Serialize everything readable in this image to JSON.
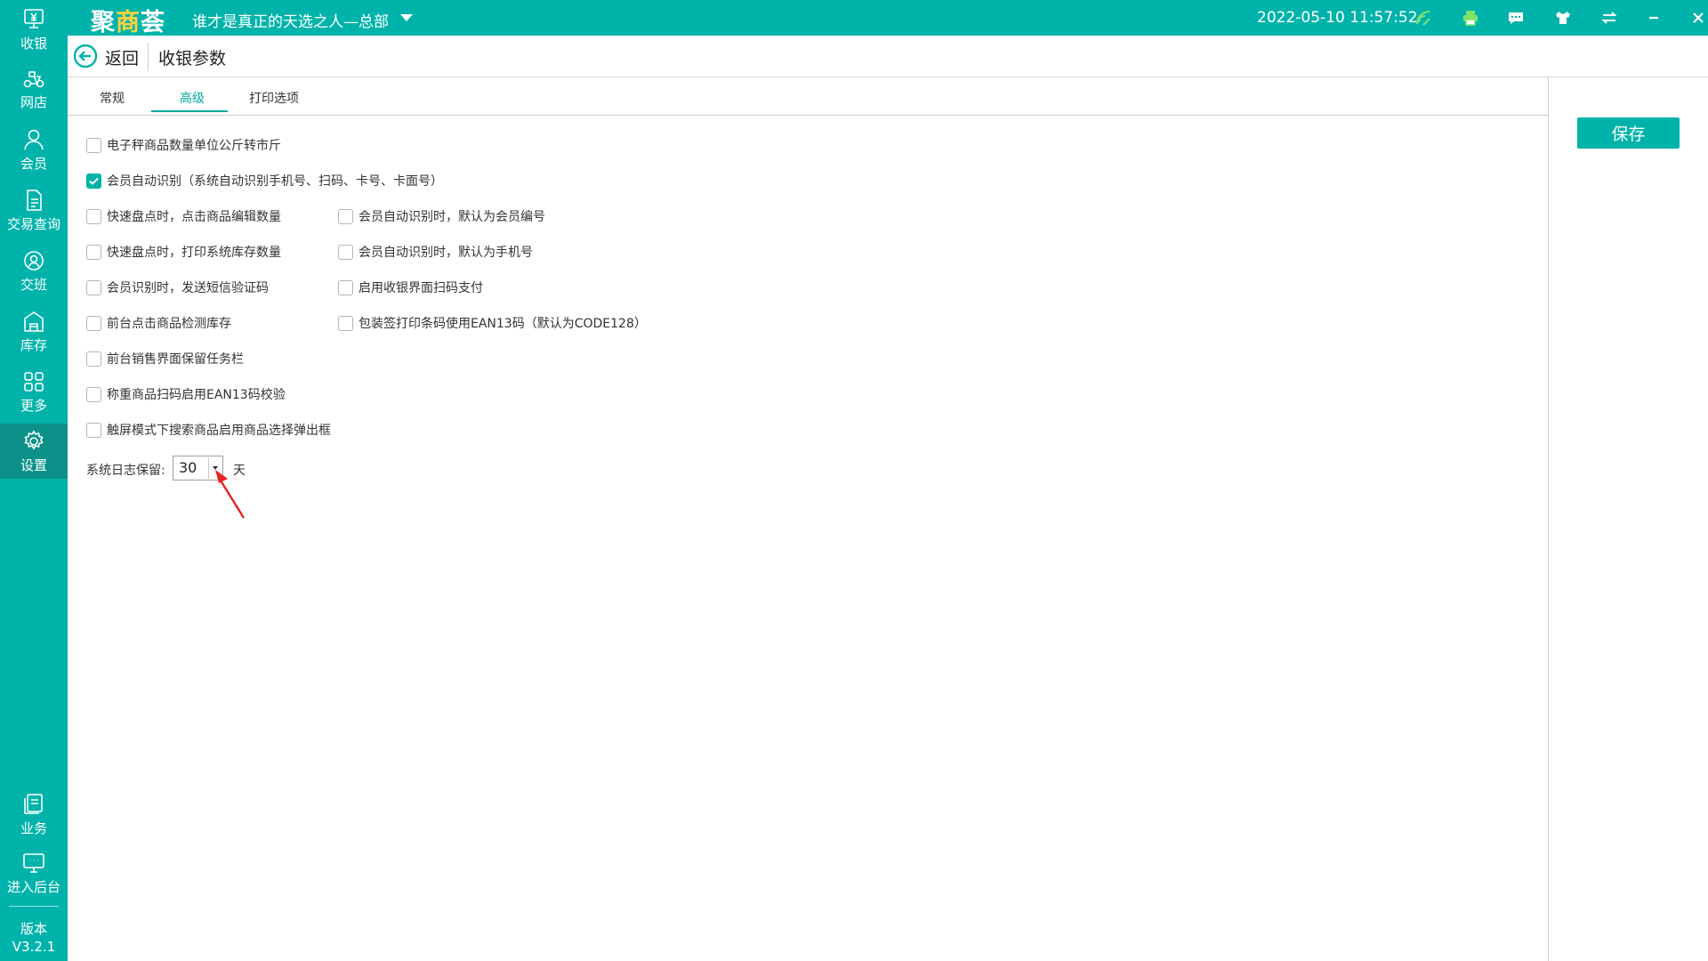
{
  "brand": {
    "part1": "聚",
    "part2": "商",
    "part3": "荟"
  },
  "store_name": "谁才是真正的天选之人—总部",
  "clock": "2022-05-10 11:57:52",
  "topbar_icons": [
    "wifi-icon",
    "printer-icon",
    "message-icon",
    "shirt-icon",
    "sync-icon",
    "minimize-icon",
    "close-icon"
  ],
  "sidebar": {
    "items": [
      {
        "label": "收银",
        "icon": "cash-register-icon"
      },
      {
        "label": "网店",
        "icon": "delivery-bike-icon"
      },
      {
        "label": "会员",
        "icon": "member-icon"
      },
      {
        "label": "交易查询",
        "icon": "document-icon"
      },
      {
        "label": "交班",
        "icon": "shift-icon"
      },
      {
        "label": "库存",
        "icon": "warehouse-icon"
      },
      {
        "label": "更多",
        "icon": "grid-icon"
      },
      {
        "label": "设置",
        "icon": "gear-icon",
        "active": true
      },
      {
        "label": "业务",
        "icon": "business-icon"
      },
      {
        "label": "进入后台",
        "icon": "monitor-icon"
      }
    ],
    "version_label": "版本",
    "version_value": "V3.2.1"
  },
  "header": {
    "back_label": "返回",
    "title": "收银参数"
  },
  "tabs": [
    {
      "label": "常规",
      "active": false
    },
    {
      "label": "高级",
      "active": true
    },
    {
      "label": "打印选项",
      "active": false
    }
  ],
  "save_label": "保存",
  "options": [
    {
      "label": "电子秤商品数量单位公斤转市斤",
      "checked": false
    },
    {
      "label": "会员自动识别（系统自动识别手机号、扫码、卡号、卡面号）",
      "checked": true
    },
    {
      "label": "快速盘点时，点击商品编辑数量",
      "checked": false
    },
    {
      "label": "会员自动识别时，默认为会员编号",
      "checked": false
    },
    {
      "label": "快速盘点时，打印系统库存数量",
      "checked": false
    },
    {
      "label": "会员自动识别时，默认为手机号",
      "checked": false
    },
    {
      "label": "会员识别时，发送短信验证码",
      "checked": false
    },
    {
      "label": "启用收银界面扫码支付",
      "checked": false
    },
    {
      "label": "前台点击商品检测库存",
      "checked": false
    },
    {
      "label": "包装签打印条码使用EAN13码（默认为CODE128）",
      "checked": false
    },
    {
      "label": "前台销售界面保留任务栏",
      "checked": false
    },
    {
      "label": "称重商品扫码启用EAN13码校验",
      "checked": false
    },
    {
      "label": "触屏模式下搜索商品启用商品选择弹出框",
      "checked": false
    }
  ],
  "log_retention": {
    "label": "系统日志保留:",
    "value": "30",
    "unit": "天"
  },
  "colors": {
    "primary": "#00b3aa",
    "active_nav": "#0b9189",
    "accent_text": "#00a99f",
    "annotation": "#e8231f"
  }
}
